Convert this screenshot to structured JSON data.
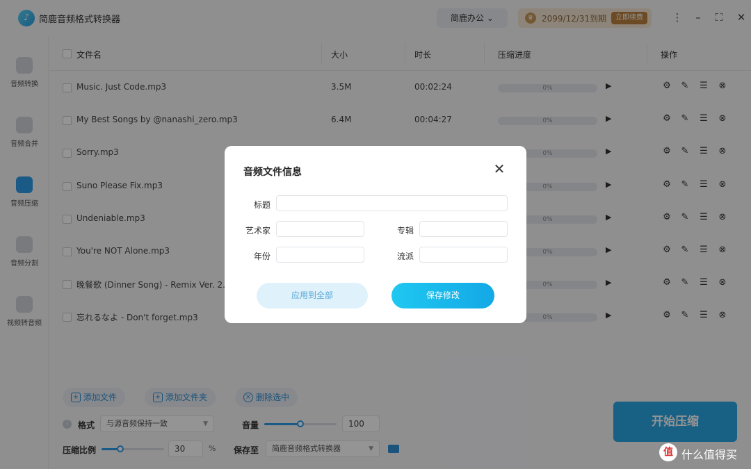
{
  "app": {
    "title": "简鹿音频格式转换器",
    "brand_dropdown": "简鹿办公",
    "vip_expiry": "2099/12/31到期",
    "renew_button": "立即续费"
  },
  "sidebar": {
    "items": [
      {
        "label": "音频转换",
        "active": false
      },
      {
        "label": "音频合并",
        "active": false
      },
      {
        "label": "音频压缩",
        "active": true
      },
      {
        "label": "音频分割",
        "active": false
      },
      {
        "label": "视频转音频",
        "active": false
      }
    ]
  },
  "table": {
    "headers": {
      "name": "文件名",
      "size": "大小",
      "duration": "时长",
      "progress": "压缩进度",
      "actions": "操作"
    },
    "rows": [
      {
        "name": "Music. Just Code.mp3",
        "size": "3.5M",
        "duration": "00:02:24",
        "progress": "0%"
      },
      {
        "name": "My Best Songs by @nanashi_zero.mp3",
        "size": "6.4M",
        "duration": "00:04:27",
        "progress": "0%"
      },
      {
        "name": "Sorry.mp3",
        "size": "",
        "duration": "",
        "progress": "0%"
      },
      {
        "name": "Suno Please Fix.mp3",
        "size": "",
        "duration": "",
        "progress": "0%"
      },
      {
        "name": "Undeniable.mp3",
        "size": "",
        "duration": "",
        "progress": "0%"
      },
      {
        "name": "You're NOT Alone.mp3",
        "size": "",
        "duration": "",
        "progress": "0%"
      },
      {
        "name": "晚餐歌 (Dinner Song) - Remix Ver. 2.mp3",
        "size": "",
        "duration": "",
        "progress": "0%"
      },
      {
        "name": "忘れるなよ - Don't forget.mp3",
        "size": "",
        "duration": "",
        "progress": "0%"
      }
    ]
  },
  "bottom": {
    "add_file": "添加文件",
    "add_folder": "添加文件夹",
    "delete_selected": "删除选中",
    "format_label": "格式",
    "format_value": "与源音频保持一致",
    "volume_label": "音量",
    "volume_value": "100",
    "volume_level": 0.5,
    "ratio_label": "压缩比例",
    "ratio_value": "30",
    "ratio_unit": "%",
    "ratio_level": 0.3,
    "save_to_label": "保存至",
    "save_to_value": "简鹿音频格式转换器",
    "start_button": "开始压缩"
  },
  "modal": {
    "title": "音频文件信息",
    "fields": {
      "title_label": "标题",
      "title_value": "",
      "artist_label": "艺术家",
      "artist_value": "",
      "album_label": "专辑",
      "album_value": "",
      "year_label": "年份",
      "year_value": "",
      "genre_label": "流派",
      "genre_value": ""
    },
    "apply_all": "应用到全部",
    "save": "保存修改"
  },
  "watermark": {
    "logo": "值",
    "text": "什么值得买"
  }
}
